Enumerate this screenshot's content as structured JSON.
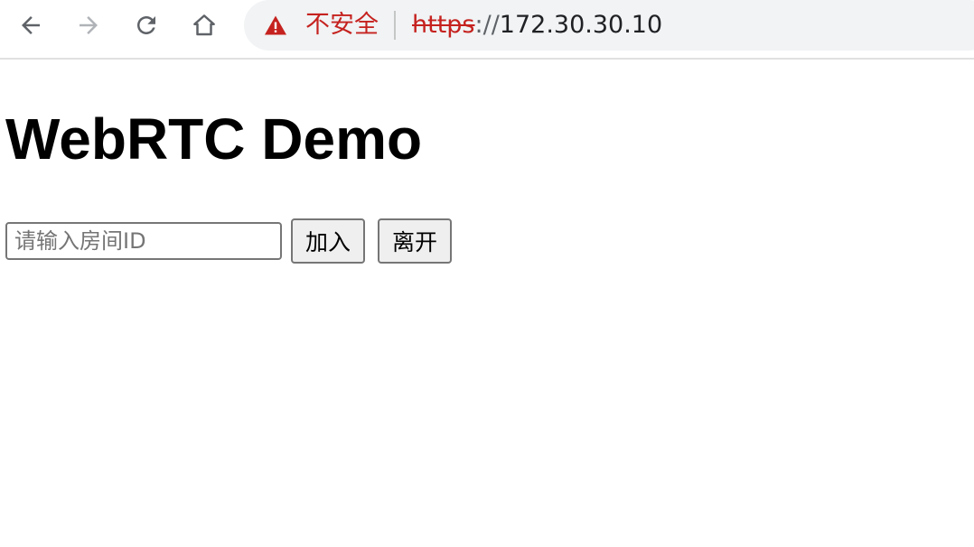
{
  "browser": {
    "nav": {
      "back": "back-arrow-icon",
      "forward": "forward-arrow-icon",
      "reload": "reload-icon",
      "home": "home-icon"
    },
    "omnibox": {
      "security_icon": "warning-triangle-icon",
      "security_label": "不安全",
      "url_scheme": "https",
      "url_separator": "://",
      "url_host": "172.30.30.10"
    },
    "colors": {
      "omnibox_bg": "#f1f3f4",
      "warning": "#c5221f"
    }
  },
  "page": {
    "title": "WebRTC Demo",
    "room_input": {
      "value": "",
      "placeholder": "请输入房间ID"
    },
    "join_button": "加入",
    "leave_button": "离开"
  }
}
